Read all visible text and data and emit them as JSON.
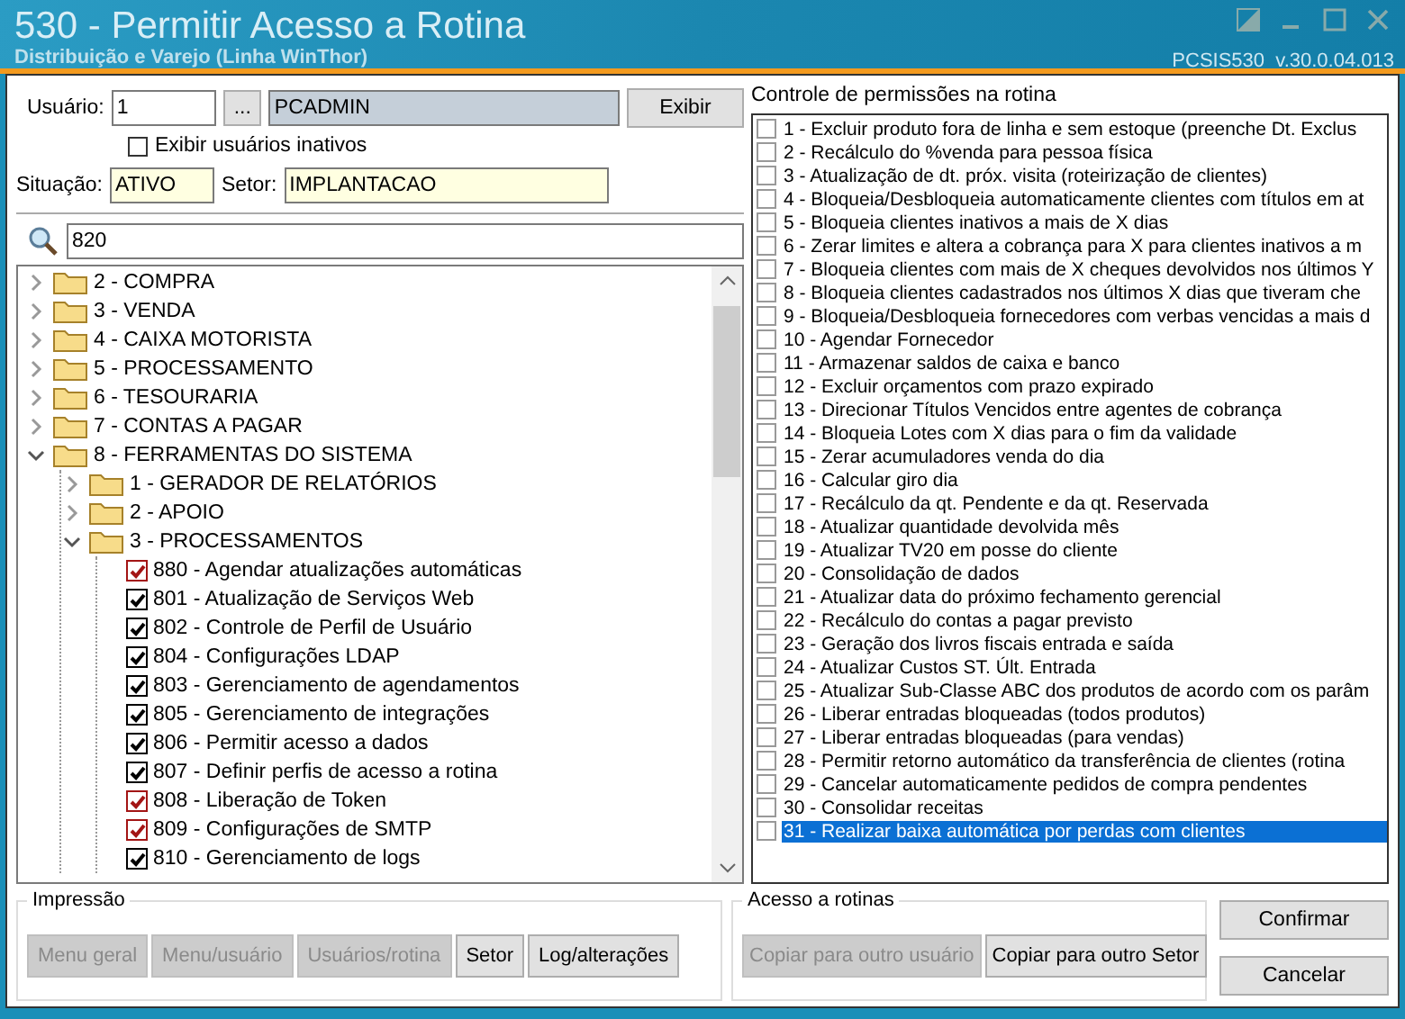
{
  "window": {
    "title": "530 - Permitir Acesso a Rotina",
    "subtitle": "Distribuição e Varejo (Linha WinThor)",
    "version": "PCSIS530  v.30.0.04.013"
  },
  "user": {
    "label": "Usuário:",
    "code": "1",
    "lookup_button": "...",
    "name": "PCADMIN",
    "show_button": "Exibir",
    "show_inactive": {
      "label": "Exibir usuários inativos",
      "checked": false
    },
    "status_label": "Situação:",
    "status": "ATIVO",
    "sector_label": "Setor:",
    "sector": "IMPLANTACAO"
  },
  "search": {
    "value": "820"
  },
  "tree": [
    {
      "kind": "folder",
      "label": "2 - COMPRA",
      "expanded": false
    },
    {
      "kind": "folder",
      "label": "3 - VENDA",
      "expanded": false
    },
    {
      "kind": "folder",
      "label": "4 - CAIXA MOTORISTA",
      "expanded": false
    },
    {
      "kind": "folder",
      "label": "5 - PROCESSAMENTO",
      "expanded": false
    },
    {
      "kind": "folder",
      "label": "6 - TESOURARIA",
      "expanded": false
    },
    {
      "kind": "folder",
      "label": "7 - CONTAS A PAGAR",
      "expanded": false
    },
    {
      "kind": "folder",
      "label": "8 - FERRAMENTAS DO SISTEMA",
      "expanded": true,
      "children": [
        {
          "kind": "folder",
          "label": "1 - GERADOR DE RELATÓRIOS",
          "expanded": false
        },
        {
          "kind": "folder",
          "label": "2 - APOIO",
          "expanded": false
        },
        {
          "kind": "folder",
          "label": "3 - PROCESSAMENTOS",
          "expanded": true,
          "children": [
            {
              "kind": "routine",
              "label": "880 - Agendar atualizações automáticas",
              "checked": true,
              "color": "#a31515"
            },
            {
              "kind": "routine",
              "label": "801 - Atualização de Serviços Web",
              "checked": true,
              "color": "#000000"
            },
            {
              "kind": "routine",
              "label": "802 - Controle de Perfil de Usuário",
              "checked": true,
              "color": "#000000"
            },
            {
              "kind": "routine",
              "label": "804 - Configurações LDAP",
              "checked": true,
              "color": "#000000"
            },
            {
              "kind": "routine",
              "label": "803 - Gerenciamento de agendamentos",
              "checked": true,
              "color": "#000000"
            },
            {
              "kind": "routine",
              "label": "805 - Gerenciamento de integrações",
              "checked": true,
              "color": "#000000"
            },
            {
              "kind": "routine",
              "label": "806 - Permitir acesso a dados",
              "checked": true,
              "color": "#000000"
            },
            {
              "kind": "routine",
              "label": "807 - Definir perfis de acesso a rotina",
              "checked": true,
              "color": "#000000"
            },
            {
              "kind": "routine",
              "label": "808 - Liberação de Token",
              "checked": true,
              "color": "#a31515"
            },
            {
              "kind": "routine",
              "label": "809 - Configurações de SMTP",
              "checked": true,
              "color": "#a31515"
            },
            {
              "kind": "routine",
              "label": "810 - Gerenciamento de logs",
              "checked": true,
              "color": "#000000"
            }
          ]
        }
      ]
    }
  ],
  "permissions": {
    "title": "Controle de permissões na rotina",
    "items": [
      {
        "label": "1 - Excluir produto fora de linha e sem estoque (preenche Dt. Exclus",
        "checked": false,
        "selected": false
      },
      {
        "label": "2 - Recálculo do %venda para pessoa física",
        "checked": false,
        "selected": false
      },
      {
        "label": "3 - Atualização de dt. próx. visita (roteirização de clientes)",
        "checked": false,
        "selected": false
      },
      {
        "label": "4 - Bloqueia/Desbloqueia automaticamente clientes com títulos em at",
        "checked": false,
        "selected": false
      },
      {
        "label": "5 - Bloqueia clientes inativos a mais de X dias",
        "checked": false,
        "selected": false
      },
      {
        "label": "6 - Zerar limites e altera a cobrança para X para clientes inativos a m",
        "checked": false,
        "selected": false
      },
      {
        "label": "7 - Bloqueia clientes com mais de X cheques devolvidos nos últimos Y",
        "checked": false,
        "selected": false
      },
      {
        "label": "8 - Bloqueia clientes cadastrados nos últimos X dias que tiveram che",
        "checked": false,
        "selected": false
      },
      {
        "label": "9 - Bloqueia/Desbloqueia fornecedores com verbas vencidas a mais d",
        "checked": false,
        "selected": false
      },
      {
        "label": "10 - Agendar Fornecedor",
        "checked": false,
        "selected": false
      },
      {
        "label": "11 - Armazenar saldos de caixa e banco",
        "checked": false,
        "selected": false
      },
      {
        "label": "12 - Excluir orçamentos com prazo expirado",
        "checked": false,
        "selected": false
      },
      {
        "label": "13 - Direcionar Títulos Vencidos entre agentes de cobrança",
        "checked": false,
        "selected": false
      },
      {
        "label": "14 - Bloqueia Lotes com X dias para o fim da validade",
        "checked": false,
        "selected": false
      },
      {
        "label": "15 - Zerar acumuladores venda do dia",
        "checked": false,
        "selected": false
      },
      {
        "label": "16 - Calcular giro dia",
        "checked": false,
        "selected": false
      },
      {
        "label": "17 - Recálculo da qt. Pendente e da qt. Reservada",
        "checked": false,
        "selected": false
      },
      {
        "label": "18 - Atualizar quantidade devolvida mês",
        "checked": false,
        "selected": false
      },
      {
        "label": "19 - Atualizar TV20 em posse do cliente",
        "checked": false,
        "selected": false
      },
      {
        "label": "20 - Consolidação de dados",
        "checked": false,
        "selected": false
      },
      {
        "label": "21 - Atualizar data do próximo fechamento gerencial",
        "checked": false,
        "selected": false
      },
      {
        "label": "22 - Recálculo do contas a pagar previsto",
        "checked": false,
        "selected": false
      },
      {
        "label": "23 - Geração dos livros fiscais entrada e saída",
        "checked": false,
        "selected": false
      },
      {
        "label": "24 - Atualizar Custos ST. Últ. Entrada",
        "checked": false,
        "selected": false
      },
      {
        "label": "25 - Atualizar Sub-Classe ABC dos produtos de acordo com os parâm",
        "checked": false,
        "selected": false
      },
      {
        "label": "26 - Liberar entradas bloqueadas (todos produtos)",
        "checked": false,
        "selected": false
      },
      {
        "label": "27 - Liberar entradas bloqueadas (para vendas)",
        "checked": false,
        "selected": false
      },
      {
        "label": "28 - Permitir retorno automático da transferência de clientes (rotina",
        "checked": false,
        "selected": false
      },
      {
        "label": "29 - Cancelar automaticamente pedidos de compra pendentes",
        "checked": false,
        "selected": false
      },
      {
        "label": "30 - Consolidar receitas",
        "checked": false,
        "selected": false
      },
      {
        "label": "31 - Realizar baixa automática por perdas com clientes",
        "checked": false,
        "selected": true
      }
    ]
  },
  "print_group": {
    "title": "Impressão",
    "buttons": [
      {
        "label": "Menu geral",
        "disabled": true
      },
      {
        "label": "Menu/usuário",
        "disabled": true
      },
      {
        "label": "Usuários/rotina",
        "disabled": true
      },
      {
        "label": "Setor",
        "disabled": false
      },
      {
        "label": "Log/alterações",
        "disabled": false
      }
    ]
  },
  "access_group": {
    "title": "Acesso a rotinas",
    "buttons": [
      {
        "label": "Copiar para outro usuário",
        "disabled": true
      },
      {
        "label": "Copiar para outro Setor",
        "disabled": false
      }
    ]
  },
  "actions": [
    {
      "label": "Confirmar"
    },
    {
      "label": "Cancelar"
    }
  ]
}
